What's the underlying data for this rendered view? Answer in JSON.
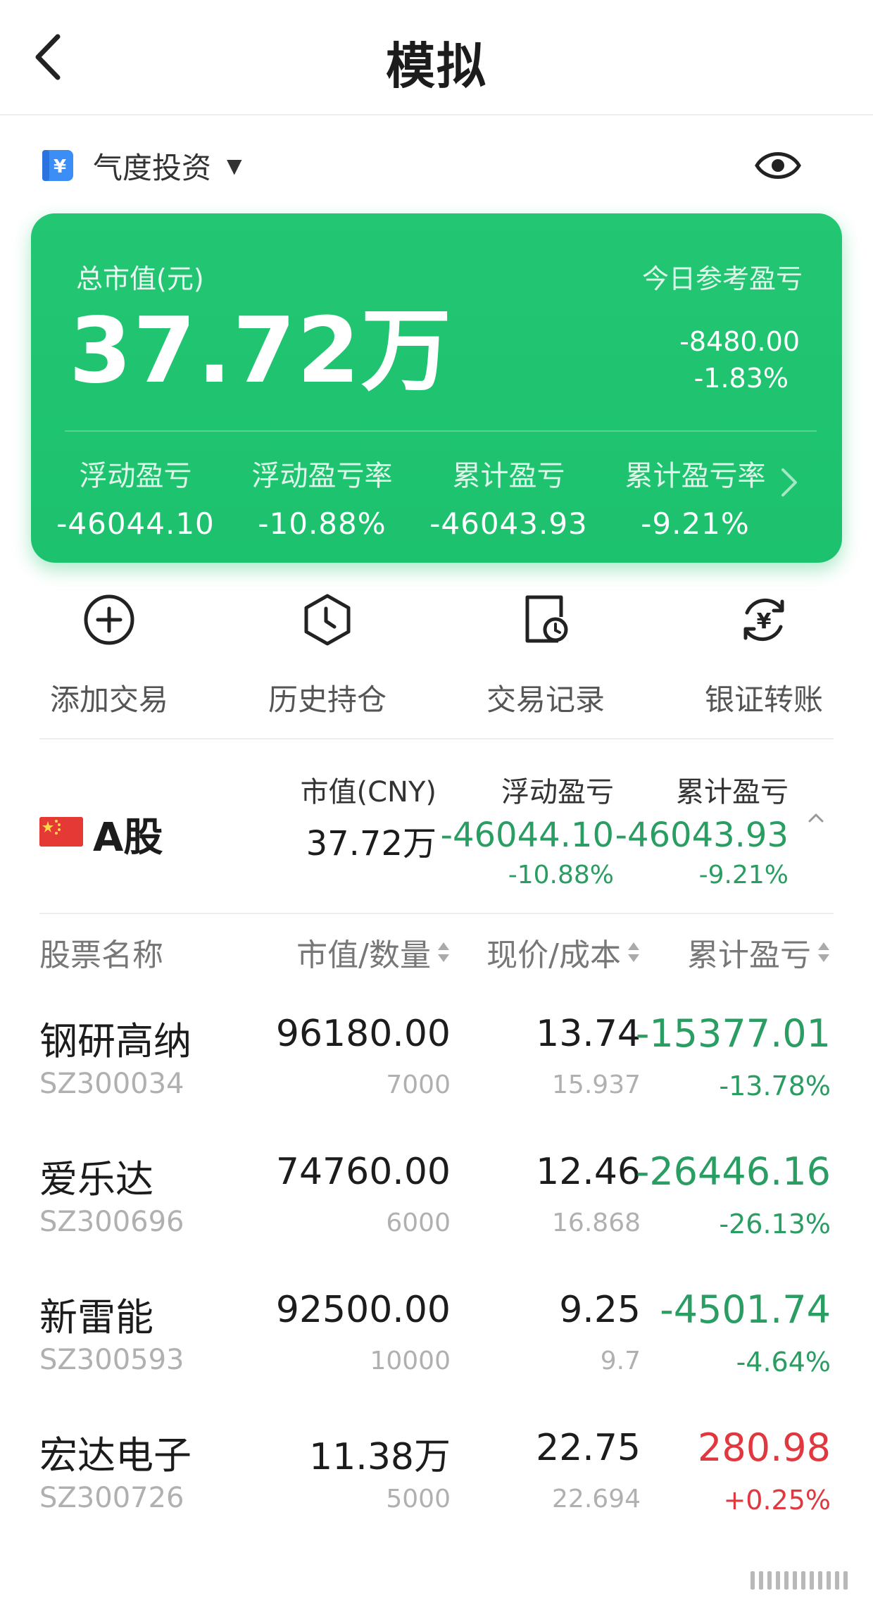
{
  "header": {
    "title": "模拟"
  },
  "account": {
    "name": "气度投资"
  },
  "summary": {
    "total_label": "总市值(元)",
    "total_value": "37.72万",
    "today_label": "今日参考盈亏",
    "today_amount": "-8480.00",
    "today_pct": "-1.83%",
    "metrics": [
      {
        "label": "浮动盈亏",
        "value": "-46044.10"
      },
      {
        "label": "浮动盈亏率",
        "value": "-10.88%"
      },
      {
        "label": "累计盈亏",
        "value": "-46043.93"
      },
      {
        "label": "累计盈亏率",
        "value": "-9.21%"
      }
    ]
  },
  "actions": [
    {
      "label": "添加交易",
      "icon": "plus-circle-icon"
    },
    {
      "label": "历史持仓",
      "icon": "clock-hexagon-icon"
    },
    {
      "label": "交易记录",
      "icon": "record-clock-icon"
    },
    {
      "label": "银证转账",
      "icon": "yuan-transfer-icon"
    }
  ],
  "market": {
    "name": "A股",
    "market_value_header": "市值(CNY)",
    "market_value": "37.72万",
    "float_header": "浮动盈亏",
    "float_value": "-46044.10",
    "float_pct": "-10.88%",
    "cum_header": "累计盈亏",
    "cum_value": "-46043.93",
    "cum_pct": "-9.21%"
  },
  "table": {
    "headers": {
      "name": "股票名称",
      "mv_qty": "市值/数量",
      "price_cost": "现价/成本",
      "cum_pnl": "累计盈亏"
    },
    "rows": [
      {
        "name": "钢研高纳",
        "code": "SZ300034",
        "market_value": "96180.00",
        "quantity": "7000",
        "price": "13.74",
        "cost": "15.937",
        "pnl": "-15377.01",
        "pnl_pct": "-13.78%"
      },
      {
        "name": "爱乐达",
        "code": "SZ300696",
        "market_value": "74760.00",
        "quantity": "6000",
        "price": "12.46",
        "cost": "16.868",
        "pnl": "-26446.16",
        "pnl_pct": "-26.13%"
      },
      {
        "name": "新雷能",
        "code": "SZ300593",
        "market_value": "92500.00",
        "quantity": "10000",
        "price": "9.25",
        "cost": "9.7",
        "pnl": "-4501.74",
        "pnl_pct": "-4.64%"
      },
      {
        "name": "宏达电子",
        "code": "SZ300726",
        "market_value": "11.38万",
        "quantity": "5000",
        "price": "22.75",
        "cost": "22.694",
        "pnl": "280.98",
        "pnl_pct": "+0.25%"
      }
    ]
  },
  "colors": {
    "card_green": "#23c672",
    "loss_green": "#2a9d63",
    "gain_red": "#e0383e"
  }
}
